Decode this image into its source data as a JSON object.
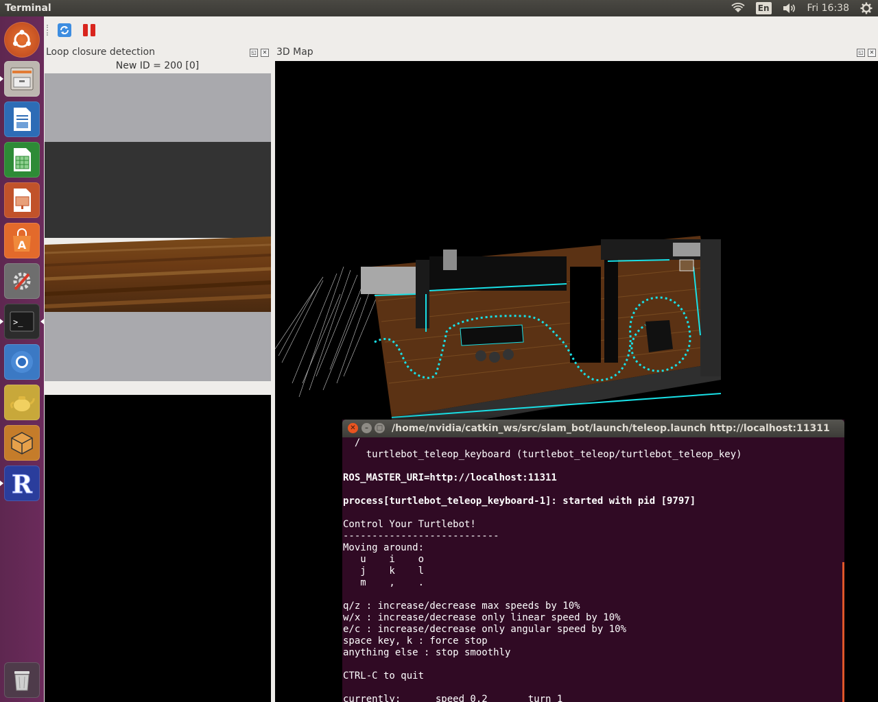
{
  "top_panel": {
    "app_title": "Terminal",
    "keyboard_layout": "En",
    "clock": "Fri 16:38",
    "tray_icons": [
      "wifi-icon",
      "keyboard-layout-icon",
      "volume-icon",
      "settings-gear-icon"
    ]
  },
  "launcher": {
    "items": [
      {
        "name": "ubuntu-dash",
        "icon": "ubuntu-logo-icon"
      },
      {
        "name": "files",
        "icon": "file-cabinet-icon"
      },
      {
        "name": "libreoffice-writer",
        "icon": "writer-document-icon"
      },
      {
        "name": "libreoffice-calc",
        "icon": "calc-spreadsheet-icon"
      },
      {
        "name": "libreoffice-impress",
        "icon": "impress-presentation-icon"
      },
      {
        "name": "software-center",
        "icon": "shopping-bag-icon"
      },
      {
        "name": "system-settings",
        "icon": "settings-wrench-icon"
      },
      {
        "name": "terminal",
        "icon": "terminal-icon"
      },
      {
        "name": "chromium",
        "icon": "chromium-icon"
      },
      {
        "name": "teapot-app",
        "icon": "teapot-icon"
      },
      {
        "name": "3d-app",
        "icon": "cube-icon"
      },
      {
        "name": "r-app",
        "icon": "r-logo-icon"
      },
      {
        "name": "trash",
        "icon": "trash-icon"
      }
    ]
  },
  "toolbar": {
    "tools": [
      "refresh-icon",
      "pause-icon"
    ]
  },
  "loop_panel": {
    "title": "Loop closure detection",
    "status": "New ID = 200 [0]"
  },
  "map_panel": {
    "title": "3D Map"
  },
  "terminal": {
    "title": "/home/nvidia/catkin_ws/src/slam_bot/launch/teleop.launch http://localhost:11311",
    "lines": [
      {
        "text": "  /",
        "bold": false
      },
      {
        "text": "    turtlebot_teleop_keyboard (turtlebot_teleop/turtlebot_teleop_key)",
        "bold": false
      },
      {
        "text": "",
        "bold": false
      },
      {
        "text": "ROS_MASTER_URI=http://localhost:11311",
        "bold": true
      },
      {
        "text": "",
        "bold": false
      },
      {
        "text": "process[turtlebot_teleop_keyboard-1]: started with pid [9797]",
        "bold": true
      },
      {
        "text": "",
        "bold": false
      },
      {
        "text": "Control Your Turtlebot!",
        "bold": false
      },
      {
        "text": "---------------------------",
        "bold": false
      },
      {
        "text": "Moving around:",
        "bold": false
      },
      {
        "text": "   u    i    o",
        "bold": false
      },
      {
        "text": "   j    k    l",
        "bold": false
      },
      {
        "text": "   m    ,    .",
        "bold": false
      },
      {
        "text": "",
        "bold": false
      },
      {
        "text": "q/z : increase/decrease max speeds by 10%",
        "bold": false
      },
      {
        "text": "w/x : increase/decrease only linear speed by 10%",
        "bold": false
      },
      {
        "text": "e/c : increase/decrease only angular speed by 10%",
        "bold": false
      },
      {
        "text": "space key, k : force stop",
        "bold": false
      },
      {
        "text": "anything else : stop smoothly",
        "bold": false
      },
      {
        "text": "",
        "bold": false
      },
      {
        "text": "CTRL-C to quit",
        "bold": false
      },
      {
        "text": "",
        "bold": false
      },
      {
        "text": "currently:      speed 0.2       turn 1",
        "bold": false
      }
    ]
  },
  "colors": {
    "launcher_bg": "#5e2750",
    "terminal_bg": "#300a24",
    "panel_bg": "#3c3b37",
    "trajectory": "#19e0e6",
    "floor_wood": "#6b3a18",
    "close_button": "#e95420"
  }
}
